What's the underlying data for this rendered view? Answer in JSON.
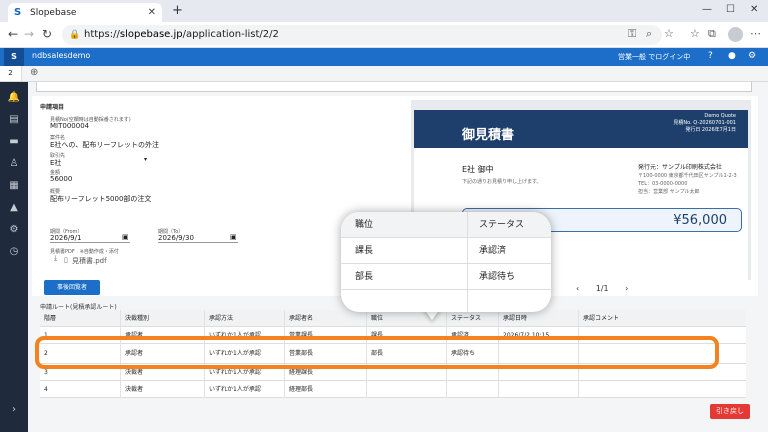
{
  "browser": {
    "tab_title": "Slopebase",
    "url_prefix": "https://",
    "url_host": "slopebase.jp",
    "url_path": "/application-list/2/2"
  },
  "app": {
    "name": "ndbsalesdemo",
    "login_status": "営業一般 でログイン中",
    "tab_number": "2"
  },
  "form": {
    "section_title": "申請項目",
    "fields": [
      {
        "label": "見積No(空欄時は自動採番されます)",
        "value": "MIT000004"
      },
      {
        "label": "案件名",
        "value": "E社への、配布リーフレットの外注"
      },
      {
        "label": "取引先",
        "value": "E社"
      },
      {
        "label": "金額",
        "value": "56000"
      },
      {
        "label": "概要",
        "value": "配布リーフレット5000部の注文"
      }
    ],
    "start_label": "期間（From）",
    "start_date": "2026/9/1",
    "end_label": "期間（To）",
    "end_date": "2026/9/30",
    "pdf_label": "見積書PDF　※自動作成・添付",
    "pdf_file": "見積書.pdf"
  },
  "quote": {
    "title": "御見積書",
    "meta_line1": "Demo Quote",
    "meta_line2": "見積No. Q-20260701-001",
    "meta_line3": "発行日 2026年7月1日",
    "client": "E社 御中",
    "client_note": "下記の通りお見積り申し上げます。",
    "issuer": "発行元：サンプル印刷株式会社",
    "issuer_addr": "〒100-0000 東京都千代田区サンプル1-2-3",
    "issuer_tel": "TEL：03-0000-0000",
    "issuer_rep": "担当：営業部 サンプル太郎",
    "amount": "¥56,000"
  },
  "approver_button": "事後回覧者",
  "pager": {
    "current": "1/1",
    "prev": "‹",
    "next": "›"
  },
  "route": {
    "title": "申請ルート(見積承認ルート)",
    "columns": [
      "階層",
      "決裁種別",
      "承認方法",
      "承認者名",
      "職位",
      "ステータス",
      "承認日時",
      "承認コメント"
    ],
    "rows": [
      [
        "1",
        "承認者",
        "いずれか1人が承認",
        "営業課長",
        "課長",
        "承認済",
        "2026/7/2 10:15",
        ""
      ],
      [
        "2",
        "承認者",
        "いずれか1人が承認",
        "営業部長",
        "部長",
        "承認待ち",
        "",
        ""
      ],
      [
        "3",
        "決裁者",
        "いずれか1人が承認",
        "経理課長",
        "",
        "",
        "",
        ""
      ],
      [
        "4",
        "決裁者",
        "いずれか1人が承認",
        "経理部長",
        "",
        "",
        "",
        ""
      ]
    ]
  },
  "popover": {
    "columns": [
      "職位",
      "ステータス"
    ],
    "rows": [
      [
        "課長",
        "承認済"
      ],
      [
        "部長",
        "承認待ち"
      ],
      [
        "",
        ""
      ]
    ]
  },
  "return_button": "引き戻し",
  "colors": {
    "primary": "#1c6ec9",
    "sidebar": "#1f2b3d",
    "highlight": "#f58220",
    "danger": "#e53935",
    "quote_band": "#1e3f6b"
  }
}
